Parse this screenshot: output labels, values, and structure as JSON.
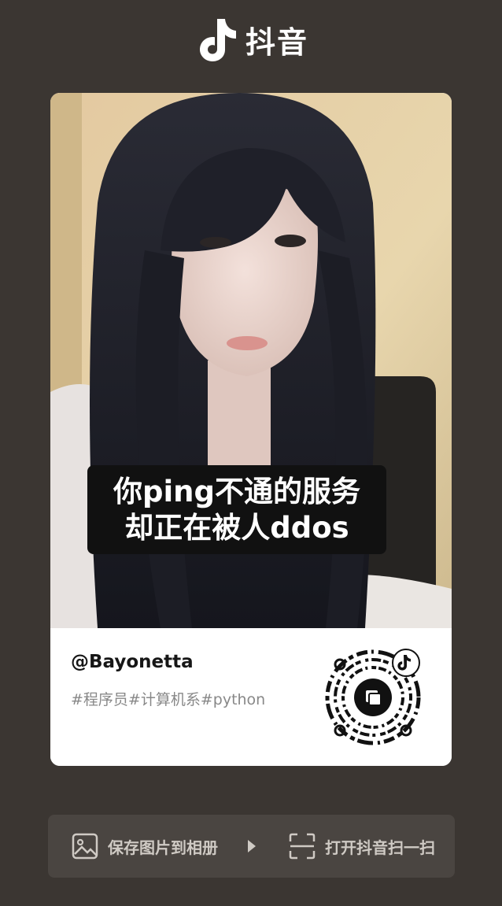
{
  "brand": {
    "name": "抖音",
    "logo_icon": "douyin-note-icon"
  },
  "card": {
    "photo": {
      "caption_lines": [
        "你ping不通的服务",
        "却正在被人ddos"
      ]
    },
    "username": "@Bayonetta",
    "tags": "#程序员#计算机系#python",
    "qr_icon": "qr-code-icon"
  },
  "actions": {
    "save_label": "保存图片到相册",
    "save_icon": "image-icon",
    "arrow_icon": "play-arrow-icon",
    "scan_label": "打开抖音扫一扫",
    "scan_icon": "scan-icon"
  }
}
